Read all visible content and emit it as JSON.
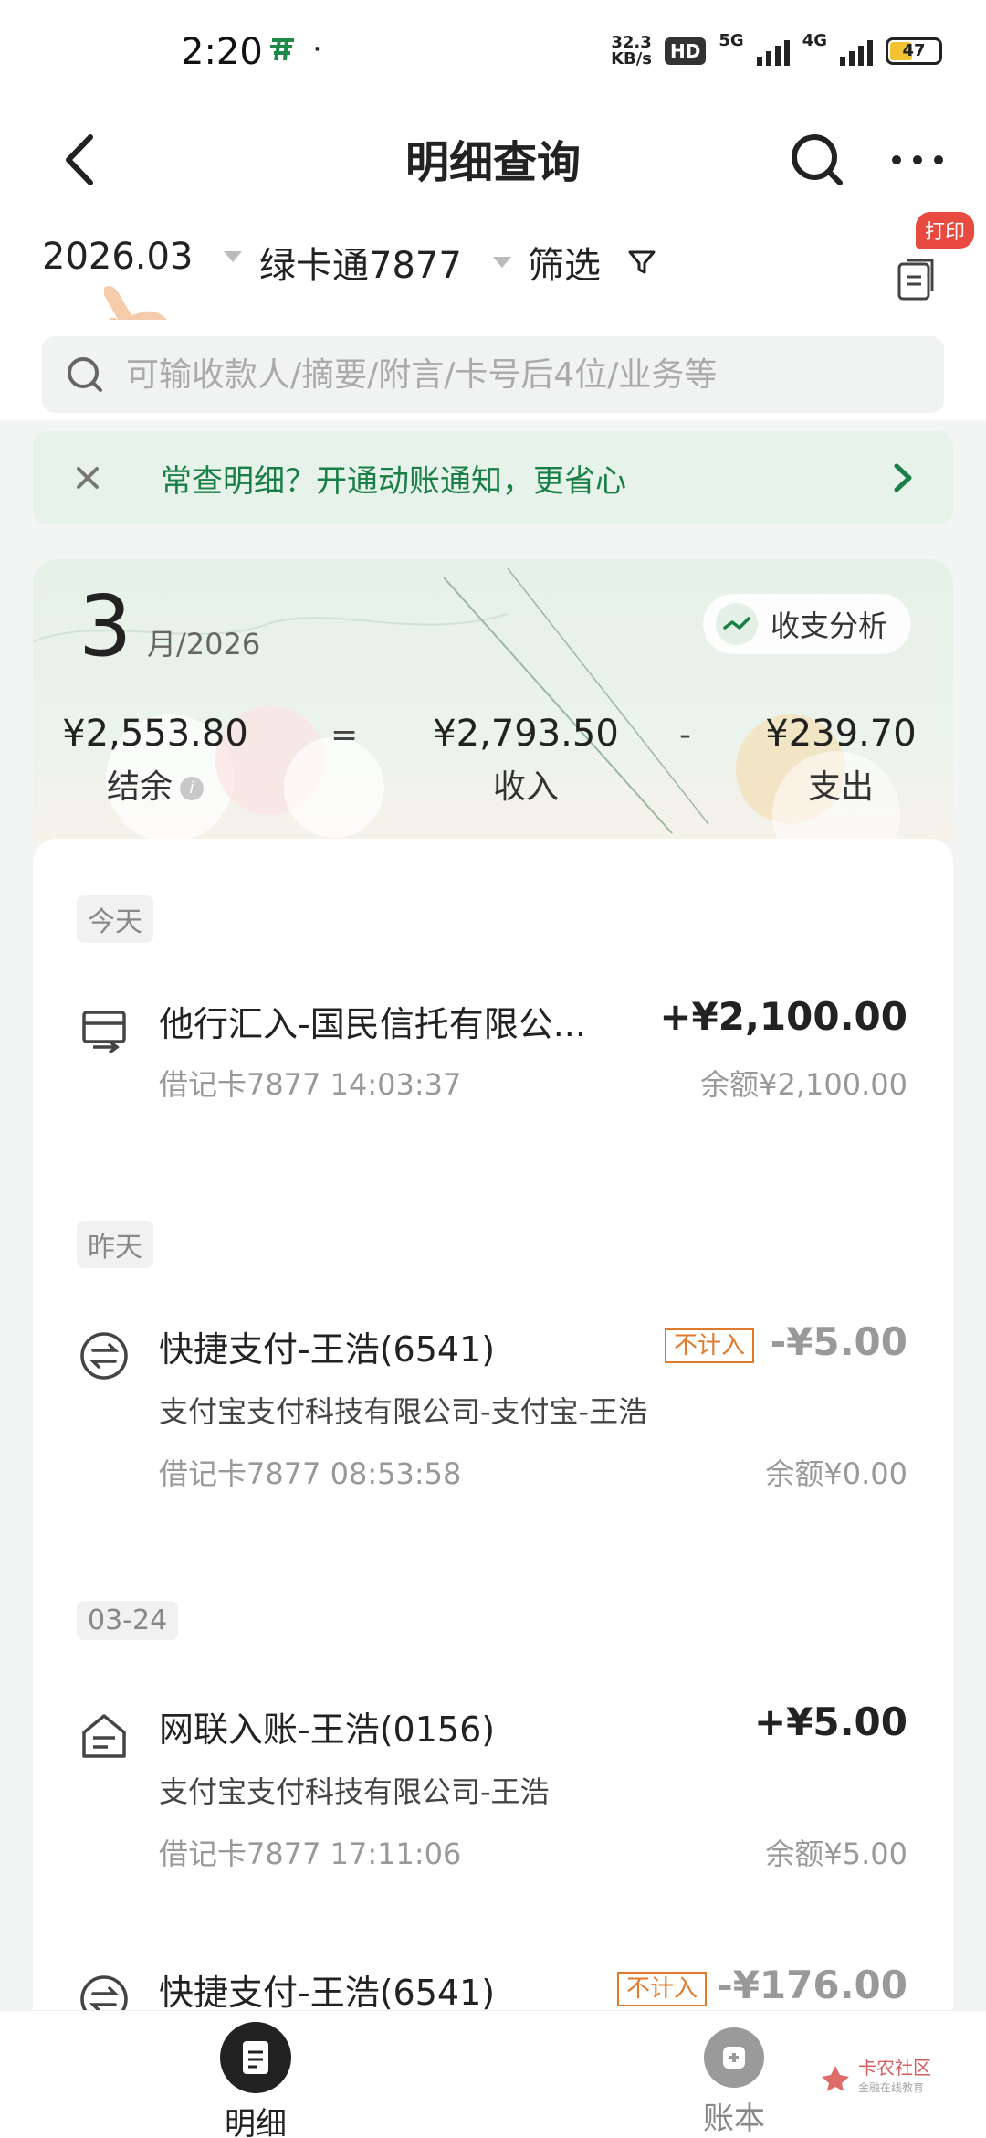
{
  "status_bar": {
    "time": "2:20",
    "dot": "·",
    "net_speed_value": "32.3",
    "net_speed_unit": "KB/s",
    "hd": "HD",
    "net_5g": "5G",
    "net_4g": "4G",
    "battery": "47",
    "battery_level": 0.47
  },
  "header": {
    "title": "明细查询"
  },
  "filters": {
    "month": "2026.03",
    "card": "绿卡通7877",
    "filter": "筛选",
    "print_badge": "打印"
  },
  "search": {
    "placeholder": "可输收款人/摘要/附言/卡号后4位/业务等"
  },
  "notice": {
    "text": "常查明细？开通动账通知，更省心"
  },
  "summary": {
    "month": "3",
    "year_suffix": "月/2026",
    "analysis_label": "收支分析",
    "balance_value": "¥2,553.80",
    "balance_label": "结余",
    "eq": "=",
    "income_value": "¥2,793.50",
    "income_label": "收入",
    "minus": "-",
    "expense_value": "¥239.70",
    "expense_label": "支出",
    "info": "i"
  },
  "groups": [
    {
      "day": "今天"
    },
    {
      "day": "昨天"
    },
    {
      "day": "03-24"
    }
  ],
  "transactions": [
    {
      "title": "他行汇入-国民信托有限公...",
      "meta": "借记卡7877 14:03:37",
      "amount": "+¥2,100.00",
      "balance": "余额¥2,100.00"
    },
    {
      "title": "快捷支付-王浩(6541)",
      "sub": "支付宝支付科技有限公司-支付宝-王浩",
      "tag": "不计入",
      "meta": "借记卡7877 08:53:58",
      "amount": "-¥5.00",
      "balance": "余额¥0.00"
    },
    {
      "title": "网联入账-王浩(0156)",
      "sub": "支付宝支付科技有限公司-王浩",
      "meta": "借记卡7877 17:11:06",
      "amount": "+¥5.00",
      "balance": "余额¥5.00"
    },
    {
      "title": "快捷支付-王浩(6541)",
      "tag": "不计入",
      "amount": "-¥176.00"
    }
  ],
  "tabbar": {
    "tabs": [
      {
        "label": "明细"
      },
      {
        "label": "账本"
      }
    ]
  },
  "watermark": {
    "title": "卡农社区",
    "sub": "金融在线教育"
  },
  "colors": {
    "brand_green": "#1a7f46",
    "tag_orange": "#e07a2c",
    "badge_red": "#e84a3f"
  }
}
